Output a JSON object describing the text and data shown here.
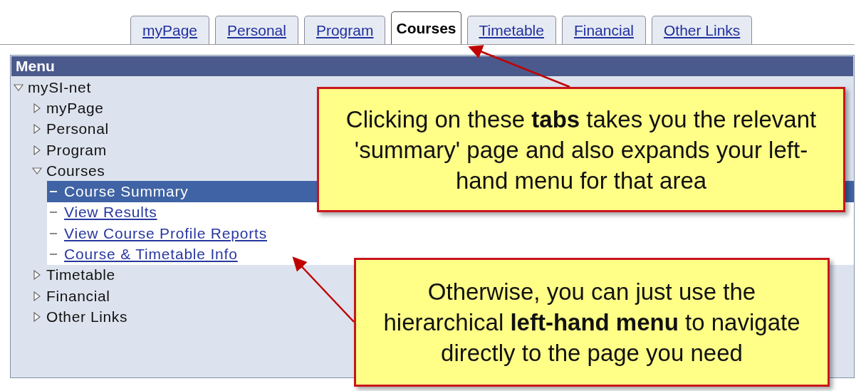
{
  "tabs": [
    {
      "label": "myPage",
      "selected": false
    },
    {
      "label": "Personal",
      "selected": false
    },
    {
      "label": "Program",
      "selected": false
    },
    {
      "label": "Courses",
      "selected": true
    },
    {
      "label": "Timetable",
      "selected": false
    },
    {
      "label": "Financial",
      "selected": false
    },
    {
      "label": "Other Links",
      "selected": false
    }
  ],
  "menu": {
    "title": "Menu",
    "tree": [
      {
        "label": "mySI-net",
        "expanded": true,
        "children": [
          {
            "label": "myPage",
            "expanded": false
          },
          {
            "label": "Personal",
            "expanded": false
          },
          {
            "label": "Program",
            "expanded": false
          },
          {
            "label": "Courses",
            "expanded": true,
            "children": [
              {
                "label": "Course Summary",
                "kind": "leaf",
                "selected": true
              },
              {
                "label": "View Results",
                "kind": "leaf",
                "selected": false
              },
              {
                "label": "View Course Profile Reports",
                "kind": "leaf",
                "selected": false
              },
              {
                "label": "Course & Timetable Info",
                "kind": "leaf",
                "selected": false
              }
            ]
          },
          {
            "label": "Timetable",
            "expanded": false
          },
          {
            "label": "Financial",
            "expanded": false
          },
          {
            "label": "Other Links",
            "expanded": false
          }
        ]
      }
    ]
  },
  "callouts": [
    {
      "text": "Clicking on these **tabs** takes you the relevant 'summary' page and also expands your left-hand menu for that area"
    },
    {
      "text": "Otherwise, you can just use the hierarchical **left-hand menu** to navigate directly to the page you need"
    }
  ]
}
